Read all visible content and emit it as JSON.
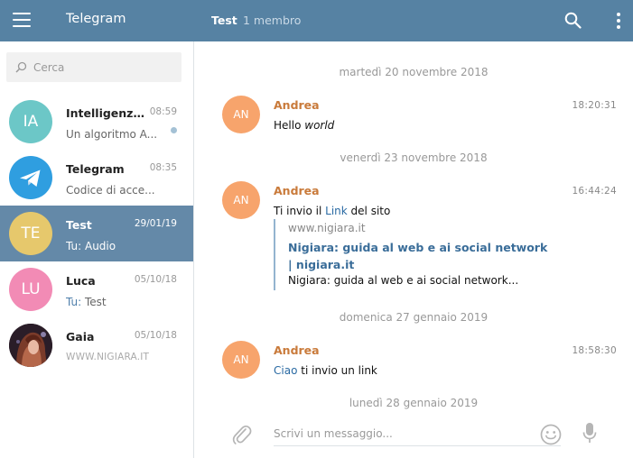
{
  "sidebar": {
    "title": "Telegram",
    "search": {
      "placeholder": "Cerca"
    },
    "dialogs": [
      {
        "name": "Intelligenza artificiale",
        "time": "08:59",
        "preview_text": "Un algoritmo A...",
        "avatar_initials": "IA",
        "avatar_color": "#6cc7c7",
        "unread": true
      },
      {
        "name": "Telegram",
        "time": "08:35",
        "preview_text": "Codice di acce...",
        "avatar_initials": "",
        "avatar_color": "#2f9ee0"
      },
      {
        "name": "Test",
        "time": "29/01/19",
        "preview_prefix": "Tu:",
        "preview_text": "Audio",
        "avatar_initials": "TE",
        "avatar_color": "#e6c86c",
        "active": true
      },
      {
        "name": "Luca",
        "time": "05/10/18",
        "preview_prefix": "Tu:",
        "preview_text": "Test",
        "avatar_initials": "LU",
        "avatar_color": "#f28bb5"
      },
      {
        "name": "Gaia",
        "time": "05/10/18",
        "preview_text": "WWW.NIGIARA.IT",
        "avatar_initials": "",
        "avatar_color": "#3a2a35"
      }
    ]
  },
  "chat": {
    "peer_name": "Test",
    "peer_status": "1 membro",
    "date_separators": [
      "martedì 20 novembre 2018",
      "venerdì 23 novembre 2018",
      "domenica 27 gennaio 2019",
      "lunedì 28 gennaio 2019"
    ],
    "messages": [
      {
        "author": "Andrea",
        "initials": "AN",
        "time": "18:20:31",
        "text_before": "Hello",
        "text_italic": "world"
      },
      {
        "author": "Andrea",
        "initials": "AN",
        "time": "16:44:24",
        "text_before": "Ti invio il",
        "link": "Link",
        "text_after": "del sito",
        "preview": {
          "site": "www.nigiara.it",
          "title": "Nigiara: guida al web e ai social network | nigiara.it",
          "description": "Nigiara: guida al web e ai social network..."
        }
      },
      {
        "author": "Andrea",
        "initials": "AN",
        "time": "18:58:30",
        "link": "Ciao",
        "text_after": "ti invio un link"
      }
    ],
    "composer": {
      "placeholder": "Scrivi un messaggio..."
    }
  },
  "colors": {
    "header_bg": "#5682a3",
    "active_dialog_bg": "#6489a8",
    "author_color": "#c97a3a",
    "link_color": "#2a6aa3",
    "sender_avatar": "#f7a46c"
  }
}
